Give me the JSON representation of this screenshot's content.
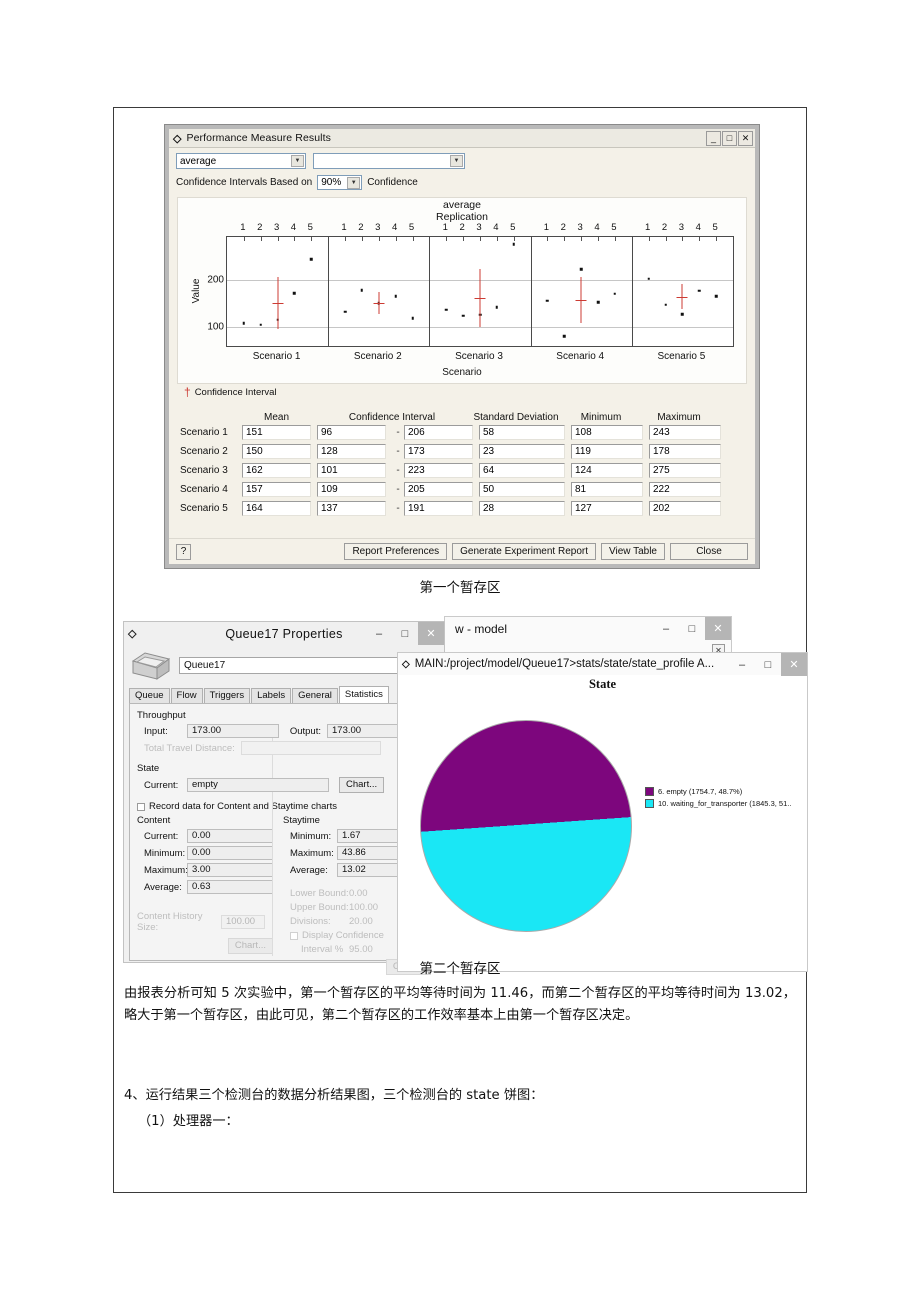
{
  "pmr_window": {
    "title": "Performance Measure Results",
    "title_icon": "chart-icon",
    "minimize": "_",
    "maximize": "□",
    "close": "✕",
    "measure_select": "average",
    "secondary_select": "",
    "ci_label": "Confidence Intervals Based on",
    "ci_value": "90%",
    "ci_suffix": "Confidence",
    "chart": {
      "title_line1": "average",
      "title_line2": "Replication",
      "ylabel": "Value",
      "xlabel": "Scenario",
      "yticks": [
        "200",
        "100"
      ],
      "replications": [
        "1",
        "2",
        "3",
        "4",
        "5"
      ],
      "scenarios": [
        "Scenario 1",
        "Scenario 2",
        "Scenario 3",
        "Scenario 4",
        "Scenario 5"
      ],
      "legend": "Confidence Interval",
      "legend_mark": "†"
    },
    "table": {
      "headers": [
        "Mean",
        "Confidence Interval",
        "Standard Deviation",
        "Minimum",
        "Maximum"
      ],
      "dash": "-",
      "rows": [
        {
          "label": "Scenario 1",
          "mean": "151",
          "ci_low": "96",
          "ci_high": "206",
          "sd": "58",
          "min": "108",
          "max": "243"
        },
        {
          "label": "Scenario 2",
          "mean": "150",
          "ci_low": "128",
          "ci_high": "173",
          "sd": "23",
          "min": "119",
          "max": "178"
        },
        {
          "label": "Scenario 3",
          "mean": "162",
          "ci_low": "101",
          "ci_high": "223",
          "sd": "64",
          "min": "124",
          "max": "275"
        },
        {
          "label": "Scenario 4",
          "mean": "157",
          "ci_low": "109",
          "ci_high": "205",
          "sd": "50",
          "min": "81",
          "max": "222"
        },
        {
          "label": "Scenario 5",
          "mean": "164",
          "ci_low": "137",
          "ci_high": "191",
          "sd": "28",
          "min": "127",
          "max": "202"
        }
      ]
    },
    "footer": {
      "help": "?",
      "report_preferences": "Report Preferences",
      "generate_report": "Generate Experiment Report",
      "view_table": "View Table",
      "close": "Close"
    }
  },
  "chart_data": {
    "type": "scatter",
    "title": "average",
    "subtitle": "Replication",
    "xlabel": "Scenario",
    "ylabel": "Value",
    "ylim": [
      60,
      290
    ],
    "yticks": [
      100,
      200
    ],
    "grid": true,
    "legend": "Confidence Interval",
    "legend_position": "below-left",
    "panels": [
      {
        "name": "Scenario 1",
        "replications": [
          1,
          2,
          3,
          4,
          5
        ],
        "values": [
          108,
          105,
          115,
          171,
          243
        ],
        "mean": 151,
        "ci_low": 96,
        "ci_high": 206
      },
      {
        "name": "Scenario 2",
        "replications": [
          1,
          2,
          3,
          4,
          5
        ],
        "values": [
          132,
          178,
          150,
          165,
          119
        ],
        "mean": 150,
        "ci_low": 128,
        "ci_high": 173
      },
      {
        "name": "Scenario 3",
        "replications": [
          1,
          2,
          3,
          4,
          5
        ],
        "values": [
          137,
          124,
          126,
          142,
          275
        ],
        "mean": 162,
        "ci_low": 101,
        "ci_high": 223
      },
      {
        "name": "Scenario 4",
        "replications": [
          1,
          2,
          3,
          4,
          5
        ],
        "values": [
          155,
          81,
          222,
          152,
          170
        ],
        "mean": 157,
        "ci_low": 109,
        "ci_high": 205
      },
      {
        "name": "Scenario 5",
        "replications": [
          1,
          2,
          3,
          4,
          5
        ],
        "values": [
          202,
          147,
          127,
          177,
          165
        ],
        "mean": 164,
        "ci_low": 137,
        "ci_high": 191
      }
    ]
  },
  "caption1": "第一个暂存区",
  "caption2": "第二个暂存区",
  "queue_window": {
    "title": "Queue17  Properties",
    "icon": "flexsim-icon",
    "minimize": "–",
    "maximize": "□",
    "close": "✕",
    "name_value": "Queue17",
    "tabs": [
      "Queue",
      "Flow",
      "Triggers",
      "Labels",
      "General",
      "Statistics"
    ],
    "active_tab": "Statistics",
    "throughput": {
      "group": "Throughput",
      "input_label": "Input:",
      "input_value": "173.00",
      "output_label": "Output:",
      "output_value": "173.00",
      "travel_label": "Total Travel Distance:",
      "travel_value": ""
    },
    "state": {
      "group": "State",
      "current_label": "Current:",
      "current_value": "empty",
      "chart_button": "Chart..."
    },
    "record_checkbox": "Record data for Content and Staytime charts",
    "content": {
      "group": "Content",
      "current_label": "Current:",
      "current_value": "0.00",
      "minimum_label": "Minimum:",
      "minimum_value": "0.00",
      "maximum_label": "Maximum:",
      "maximum_value": "3.00",
      "average_label": "Average:",
      "average_value": "0.63",
      "history_label": "Content History Size:",
      "history_value": "100.00",
      "chart_button": "Chart..."
    },
    "staytime": {
      "group": "Staytime",
      "minimum_label": "Minimum:",
      "minimum_value": "1.67",
      "maximum_label": "Maximum:",
      "maximum_value": "43.86",
      "average_label": "Average:",
      "average_value": "13.02",
      "lower_label": "Lower Bound:",
      "lower_value": "0.00",
      "upper_label": "Upper Bound:",
      "upper_value": "100.00",
      "divisions_label": "Divisions:",
      "divisions_value": "20.00",
      "confidence_checkbox": "Display Confidence",
      "interval_label": "Interval %",
      "interval_value": "95.00",
      "chart_button": "Chart..."
    }
  },
  "model_window": {
    "title": "w - model",
    "minimize": "–",
    "maximize": "□",
    "close": "✕",
    "inner_close": "✕"
  },
  "pie_window": {
    "icon": "chart-icon",
    "title": "MAIN:/project/model/Queue17>stats/state/state_profile A...",
    "minimize": "–",
    "maximize": "□",
    "close": "✕",
    "chart_title": "State",
    "legend": [
      {
        "label": "6. empty (1754.7, 48.7%)",
        "color": "#7d067d"
      },
      {
        "label": "10. waiting_for_transporter (1845.3, 51..",
        "color": "#1ae7f5"
      }
    ]
  },
  "pie_chart_data": {
    "type": "pie",
    "title": "State",
    "labels": [
      "6. empty",
      "10. waiting_for_transporter"
    ],
    "values": [
      1754.7,
      1845.3
    ],
    "percents": [
      48.7,
      51.3
    ],
    "colors": [
      "#7d067d",
      "#1ae7f5"
    ]
  },
  "body_text": {
    "para1": "由报表分析可知 5 次实验中，第一个暂存区的平均等待时间为 11.46，而第二个暂存区的平均等待时间为 13.02，略大于第一个暂存区，由此可见，第二个暂存区的工作效率基本上由第一个暂存区决定。",
    "para2": "4、运行结果三个检测台的数据分析结果图，三个检测台的 state 饼图：",
    "para3": "（1）处理器一："
  }
}
